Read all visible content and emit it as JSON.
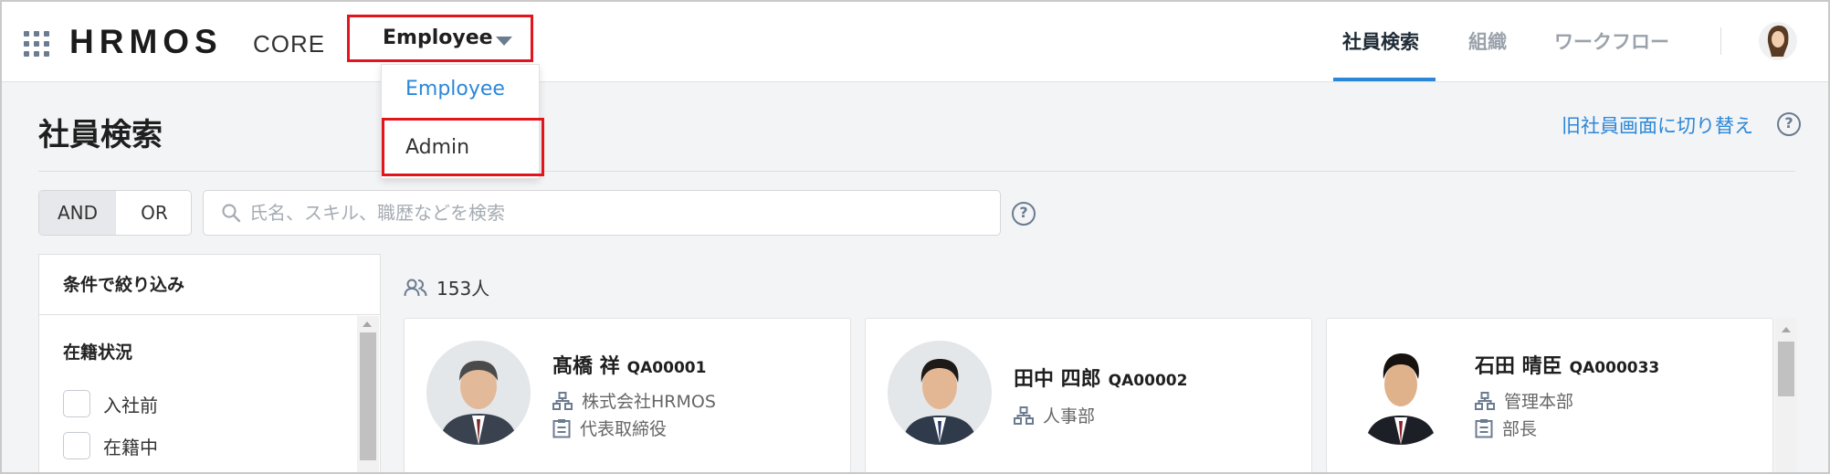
{
  "app": {
    "logo_text": "HRMOS",
    "logo_sub": "CORE",
    "mode_selected": "Employee"
  },
  "mode_menu": {
    "items": [
      "Employee",
      "Admin"
    ]
  },
  "nav": {
    "items": [
      "社員検索",
      "組織",
      "ワークフロー"
    ],
    "active": "社員検索"
  },
  "page": {
    "title": "社員検索",
    "switch_link": "旧社員画面に切り替え"
  },
  "search": {
    "and_label": "AND",
    "or_label": "OR",
    "placeholder": "氏名、スキル、職歴などを検索",
    "value": ""
  },
  "filter": {
    "header": "条件で絞り込み",
    "section_title": "在籍状況",
    "options": [
      "入社前",
      "在籍中"
    ]
  },
  "results": {
    "count": "153人",
    "cards": [
      {
        "name": "髙橋 祥",
        "code": "QA00001",
        "org": "株式会社HRMOS",
        "position": "代表取締役"
      },
      {
        "name": "田中 四郎",
        "code": "QA00002",
        "org": "人事部",
        "position": ""
      },
      {
        "name": "石田 晴臣",
        "code": "QA000033",
        "org": "管理本部",
        "position": "部長"
      }
    ]
  },
  "colors": {
    "accent": "#2b87d8",
    "highlight_box": "#e3151c",
    "icon": "#6b7b90"
  }
}
